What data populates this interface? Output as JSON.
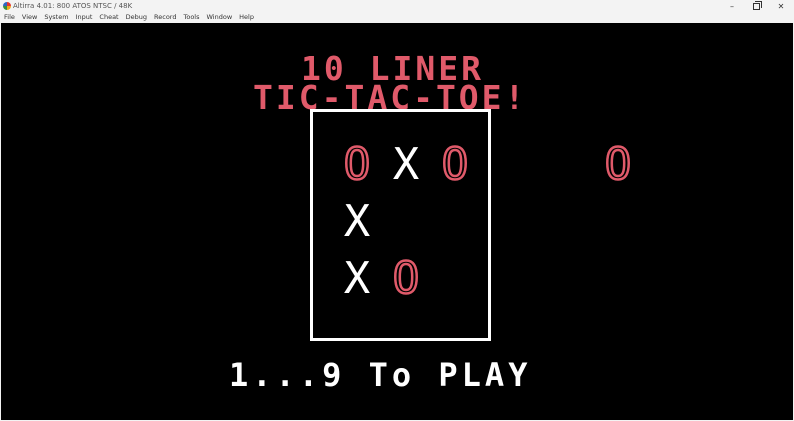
{
  "window": {
    "title": "Altirra 4.01: 800 ATOS NTSC / 48K",
    "controls": {
      "minimize": "–",
      "maximize": "",
      "close": "✕"
    }
  },
  "menu": {
    "items": [
      "File",
      "View",
      "System",
      "Input",
      "Cheat",
      "Debug",
      "Record",
      "Tools",
      "Window",
      "Help"
    ]
  },
  "game": {
    "title_line1": "10 LINER",
    "title_line2": "TIC-TAC-TOE!",
    "board": [
      "O",
      "X",
      "O",
      "X",
      "",
      "",
      "X",
      "O",
      ""
    ],
    "side_piece": "O",
    "prompt": "1...9 To PLAY",
    "colors": {
      "o_mark": "#e05a6a",
      "x_mark": "#ffffff",
      "title": "#e05a6a",
      "background": "#000000"
    }
  }
}
